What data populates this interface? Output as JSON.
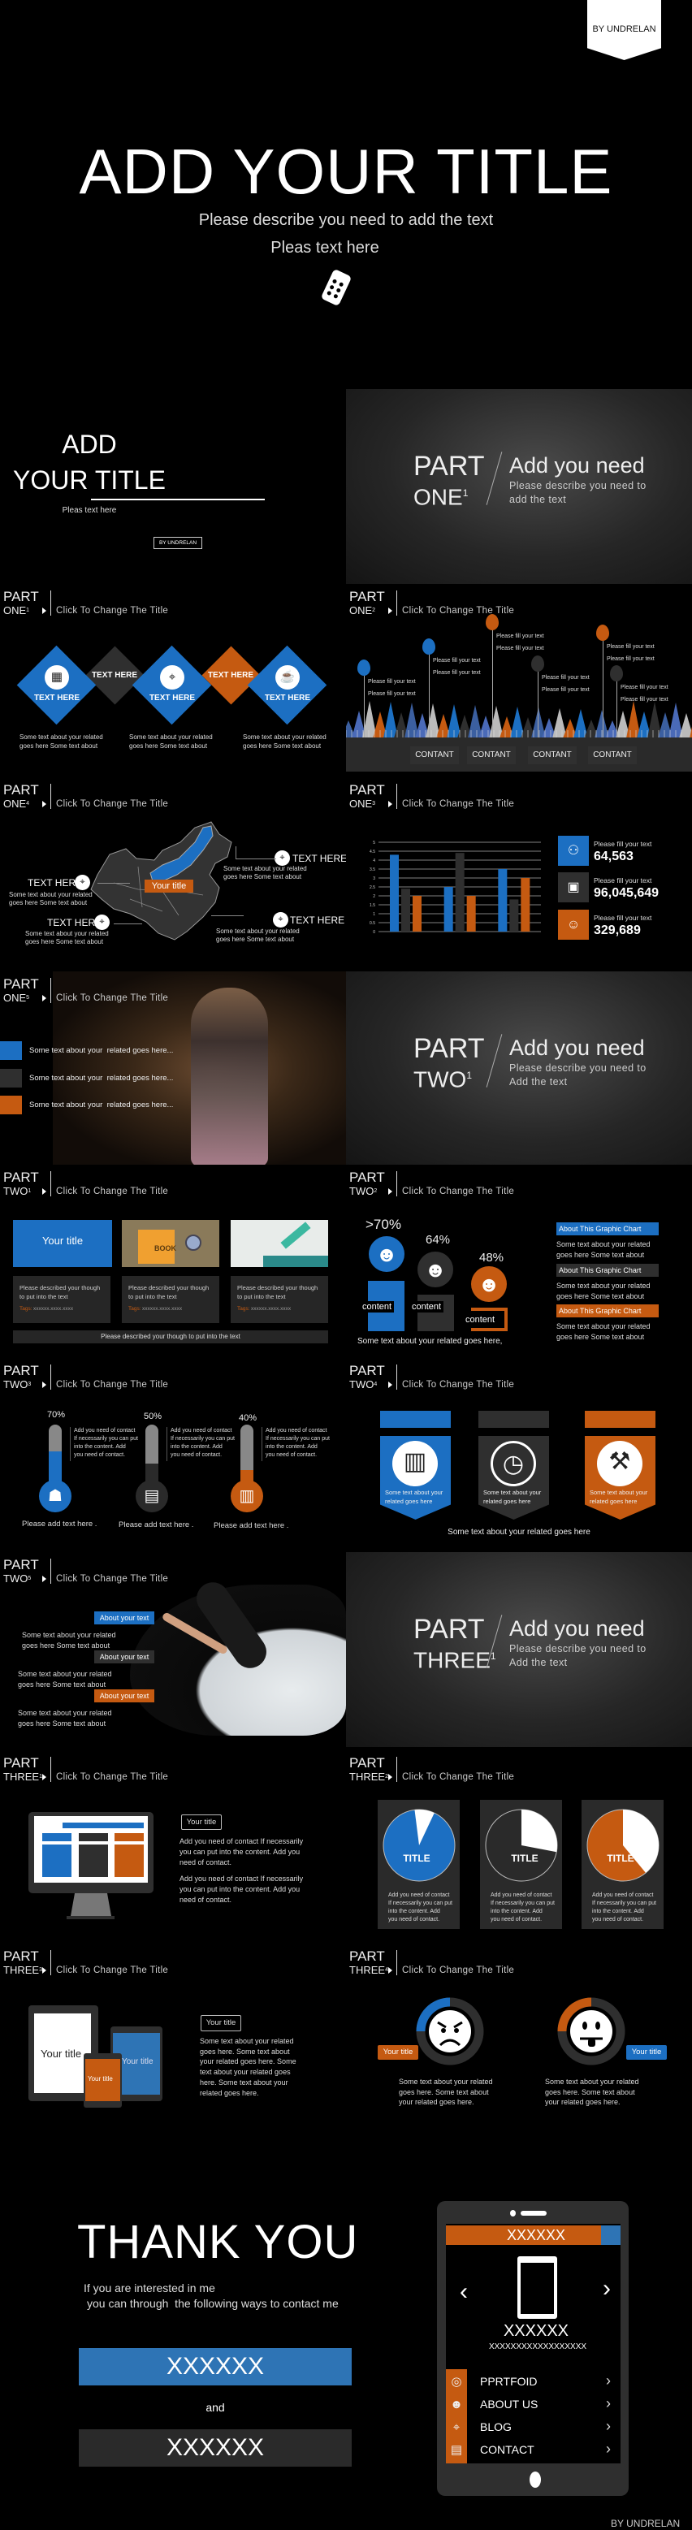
{
  "colors": {
    "blue": "#1c6fc2",
    "orange": "#c55a11",
    "dark": "#2f2f2f",
    "background": "#000000"
  },
  "hero": {
    "badge": "BY UNDRELAN",
    "title": "ADD YOUR TITLE",
    "subtitle": "Please describe you need to add the text",
    "tagline": "Pleas text here",
    "icon": "remote-control-icon"
  },
  "cover": {
    "line1": "ADD",
    "line2": "YOUR TITLE",
    "tagline": "Pleas text here",
    "badge": "BY UNDRELAN"
  },
  "parts": {
    "one": {
      "part": "PART",
      "name": "ONE",
      "num": "1",
      "heading": "Add you need",
      "desc1": "Please describe you need to",
      "desc2": "add the text"
    },
    "two": {
      "part": "PART",
      "name": "TWO",
      "num": "1",
      "heading": "Add you need",
      "desc1": "Please describe you need to",
      "desc2": "Add the text"
    },
    "three": {
      "part": "PART",
      "name": "THREE",
      "num": "1",
      "heading": "Add you need",
      "desc1": "Please describe you need to",
      "desc2": "Add the text"
    }
  },
  "headers": {
    "diamonds": {
      "part": "PART",
      "name": "ONE",
      "num": "1",
      "title": "Click To Change The Title"
    },
    "balloons": {
      "part": "PART",
      "name": "ONE",
      "num": "2",
      "title": "Click To Change The Title"
    },
    "map": {
      "part": "PART",
      "name": "ONE",
      "num": "4",
      "title": "Click To Change The Title"
    },
    "bars": {
      "part": "PART",
      "name": "ONE",
      "num": "3",
      "title": "Click To Change The Title"
    },
    "photo": {
      "part": "PART",
      "name": "ONE",
      "num": "5",
      "title": "Click To Change The Title"
    },
    "cards": {
      "part": "PART",
      "name": "TWO",
      "num": "1",
      "title": "Click To Change The Title"
    },
    "people": {
      "part": "PART",
      "name": "TWO",
      "num": "2",
      "title": "Click To Change The Title"
    },
    "thermo": {
      "part": "PART",
      "name": "TWO",
      "num": "3",
      "title": "Click To Change The Title"
    },
    "banners": {
      "part": "PART",
      "name": "TWO",
      "num": "4",
      "title": "Click To Change The Title"
    },
    "curve": {
      "part": "PART",
      "name": "TWO",
      "num": "5",
      "title": "Click To Change The Title"
    },
    "monitor": {
      "part": "PART",
      "name": "THREE",
      "num": "1",
      "title": "Click To Change The Title"
    },
    "pies": {
      "part": "PART",
      "name": "THREE",
      "num": "2",
      "title": "Click To Change The Title"
    },
    "devices": {
      "part": "PART",
      "name": "THREE",
      "num": "3",
      "title": "Click To Change The Title"
    },
    "faces": {
      "part": "PART",
      "name": "THREE",
      "num": "4",
      "title": "Click To Change The Title"
    }
  },
  "diamonds": {
    "main": [
      {
        "label": "TEXT HERE",
        "icon": "calculator-icon"
      },
      {
        "label": "TEXT HERE",
        "icon": "pin-icon"
      },
      {
        "label": "TEXT HERE",
        "icon": "coffee-icon"
      }
    ],
    "small": [
      "TEXT HERE",
      "TEXT HERE"
    ],
    "captions": [
      [
        "Some text about your related",
        "goes here Some text about"
      ],
      [
        "Some text about your related",
        "goes here Some text about"
      ],
      [
        "Some text about your related",
        "goes here Some text about"
      ]
    ]
  },
  "balloons": {
    "pins": [
      {
        "color": "blue",
        "line1": "Please fill your text",
        "line2": "Please fill your text"
      },
      {
        "color": "blue",
        "line1": "Please fill your text",
        "line2": "Please fill your text"
      },
      {
        "color": "orange",
        "line1": "Please fill your text",
        "line2": "Please fill your text"
      },
      {
        "color": "dark",
        "line1": "Please fill your text",
        "line2": "Please fill your text"
      },
      {
        "color": "orange",
        "line1": "Please fill your text",
        "line2": "Please fill your text"
      },
      {
        "color": "dark",
        "line1": "Please fill your text",
        "line2": "Please fill your text"
      }
    ],
    "buttons": [
      "CONTANT",
      "CONTANT",
      "CONTANT",
      "CONTANT"
    ]
  },
  "map": {
    "badge": "Your title",
    "callouts": [
      {
        "title": "TEXT HERE",
        "line1": "Some text about your related",
        "line2": "goes here Some text about"
      },
      {
        "title": "TEXT HERE",
        "line1": "Some text about your related",
        "line2": "goes here Some text about"
      },
      {
        "title": "TEXT HERE",
        "line1": "Some text about your related",
        "line2": "goes here Some text about"
      },
      {
        "title": "TEXT HERE",
        "line1": "Some text about your related",
        "line2": "goes here Some text about"
      }
    ]
  },
  "chart_data": {
    "type": "bar",
    "ylim": [
      0,
      5
    ],
    "yticks": [
      "0",
      "0.5",
      "1",
      "1.5",
      "2",
      "2.5",
      "3",
      "3.5",
      "4",
      "4.5",
      "5"
    ],
    "grid": true,
    "series": [
      {
        "color": "#1c6fc2",
        "values": [
          4.3,
          2.5,
          3.5
        ]
      },
      {
        "color": "#2f2f2f",
        "values": [
          2.4,
          4.4,
          1.8
        ]
      },
      {
        "color": "#c55a11",
        "values": [
          2.0,
          2.0,
          3.0
        ]
      }
    ]
  },
  "stats": [
    {
      "icon": "group-icon",
      "color": "blue",
      "label": "Please fill your text",
      "value": "64,563"
    },
    {
      "icon": "camera-icon",
      "color": "dark",
      "label": "Please fill your text",
      "value": "96,045,649"
    },
    {
      "icon": "person-icon",
      "color": "orange",
      "label": "Please fill your text",
      "value": "329,689"
    }
  ],
  "photo": {
    "items": [
      {
        "color": "blue",
        "text": "Some text about your  related goes here..."
      },
      {
        "color": "dark",
        "text": "Some text about your  related goes here..."
      },
      {
        "color": "orange",
        "text": "Some text about your  related goes here..."
      }
    ]
  },
  "cards": {
    "first_title": "Your title",
    "images": [
      "BOOK"
    ],
    "items": [
      {
        "line1": "Please described your though",
        "line2": "to put into the text",
        "tag_label": "Tags:",
        "tag_value": "xxxxxx.xxxx.xxxx"
      },
      {
        "line1": "Please described your though",
        "line2": "to put into the text",
        "tag_label": "Tags:",
        "tag_value": "xxxxxx.xxxx.xxxx"
      },
      {
        "line1": "Please described your though",
        "line2": "to put into the text",
        "tag_label": "Tags:",
        "tag_value": "xxxxxx.xxxx.xxxx"
      }
    ],
    "footer": "Please described your though to put into the text"
  },
  "people": {
    "items": [
      {
        "percent": ">70%",
        "color": "blue",
        "label": "content"
      },
      {
        "percent": "64%",
        "color": "dark",
        "label": "content"
      },
      {
        "percent": "48%",
        "color": "orange",
        "label": "content"
      }
    ],
    "caption": "Some text about your related goes here,",
    "notes": [
      {
        "title": "About This Graphic Chart",
        "color": "blue",
        "line1": "Some text about your related",
        "line2": "goes here Some text about"
      },
      {
        "title": "About This Graphic Chart",
        "color": "dark",
        "line1": "Some text about your related",
        "line2": "goes here Some text about"
      },
      {
        "title": "About This Graphic Chart",
        "color": "orange",
        "line1": "Some text about your related",
        "line2": "goes here Some text about"
      }
    ]
  },
  "thermo": {
    "items": [
      {
        "percent_label": "70%",
        "level": 70,
        "color": "blue",
        "icon": "bank-icon",
        "lines": [
          "Add you need of contact",
          "If necessarily you can put",
          "into the content. Add",
          "you need of contact."
        ],
        "caption": "Please add text here ."
      },
      {
        "percent_label": "50%",
        "level": 50,
        "color": "dark",
        "icon": "notepad-icon",
        "lines": [
          "Add you need of contact",
          "If necessarily you can put",
          "into the content. Add",
          "you need of contact."
        ],
        "caption": "Please add text here ."
      },
      {
        "percent_label": "40%",
        "level": 40,
        "color": "orange",
        "icon": "building-icon",
        "lines": [
          "Add you need of contact",
          "If necessarily you can put",
          "into the content. Add",
          "you need of contact."
        ],
        "caption": "Please add text here ."
      }
    ]
  },
  "banners": {
    "items": [
      {
        "color": "blue",
        "icon": "book-icon",
        "line1": "Some text about your",
        "line2": "related goes here"
      },
      {
        "color": "dark",
        "icon": "gauge-icon",
        "line1": "Some text about your",
        "line2": "related goes here"
      },
      {
        "color": "orange",
        "icon": "tools-icon",
        "line1": "Some text about your",
        "line2": "related goes here"
      }
    ],
    "caption": "Some text about your related goes here"
  },
  "curve": {
    "items": [
      {
        "label": "About your text",
        "color": "blue",
        "line1": "Some text about your related",
        "line2": "goes here Some text about"
      },
      {
        "label": "About your text",
        "color": "dark",
        "line1": "Some text about your related",
        "line2": "goes here Some text about"
      },
      {
        "label": "About your text",
        "color": "orange",
        "line1": "Some text about your related",
        "line2": "goes here Some text about"
      }
    ]
  },
  "monitor": {
    "title": "Your title",
    "para1": [
      "Add you need of contact If necessarily",
      "you can put into the content. Add you",
      "need of contact."
    ],
    "para2": [
      "Add you need of contact If necessarily",
      "you can put into the content. Add you",
      "need of contact."
    ]
  },
  "pies": {
    "items": [
      {
        "title": "TITLE",
        "color": "blue",
        "fill_percent": 91,
        "lines": [
          "Add you need of contact",
          "If necessarily you can put",
          "into the content. Add",
          "you need of contact."
        ]
      },
      {
        "title": "TITLE",
        "color": "dark",
        "fill_percent": 72,
        "lines": [
          "Add you need of contact",
          "If necessarily you can put",
          "into the content. Add",
          "you need of contact."
        ]
      },
      {
        "title": "TITLE",
        "color": "orange",
        "fill_percent": 61,
        "lines": [
          "Add you need of contact",
          "If necessarily you can put",
          "into the content. Add",
          "you need of contact."
        ]
      }
    ]
  },
  "devices": {
    "tablet_title": "Your title",
    "blue_title": "Your title",
    "phone_title": "Your title",
    "title": "Your title",
    "lines": [
      "Some text about your related",
      "goes here. Some text about",
      "your related goes here. Some",
      "text about your related goes",
      "here. Some text about your",
      "related goes here."
    ]
  },
  "faces": {
    "items": [
      {
        "label": "Your title",
        "color": "orange",
        "ring_color": "blue",
        "ring_percent": 25,
        "mood": "angry",
        "lines": [
          "Some text about your related",
          "goes here. Some text about",
          "your related goes here."
        ]
      },
      {
        "label": "Your title",
        "color": "blue",
        "ring_color": "orange",
        "ring_percent": 25,
        "mood": "silly",
        "lines": [
          "Some text about your related",
          "goes here. Some text about",
          "your related goes here."
        ]
      }
    ]
  },
  "thanks": {
    "title": "THANK YOU",
    "line1": "If you are interested in me",
    "line2": "you can through  the following ways to contact me",
    "primary": "XXXXXX",
    "and": "and",
    "secondary": "XXXXXX",
    "phone": {
      "header": "XXXXXX",
      "name": "XXXXXX",
      "sub": "XXXXXXXXXXXXXXXXXX",
      "menu": [
        {
          "label": "PPRTFOID",
          "icon": "globe-icon"
        },
        {
          "label": "ABOUT US",
          "icon": "person-icon"
        },
        {
          "label": "BLOG",
          "icon": "mouse-icon"
        },
        {
          "label": "CONTACT",
          "icon": "folder-icon"
        }
      ]
    },
    "footer": "BY UNDRELAN"
  }
}
